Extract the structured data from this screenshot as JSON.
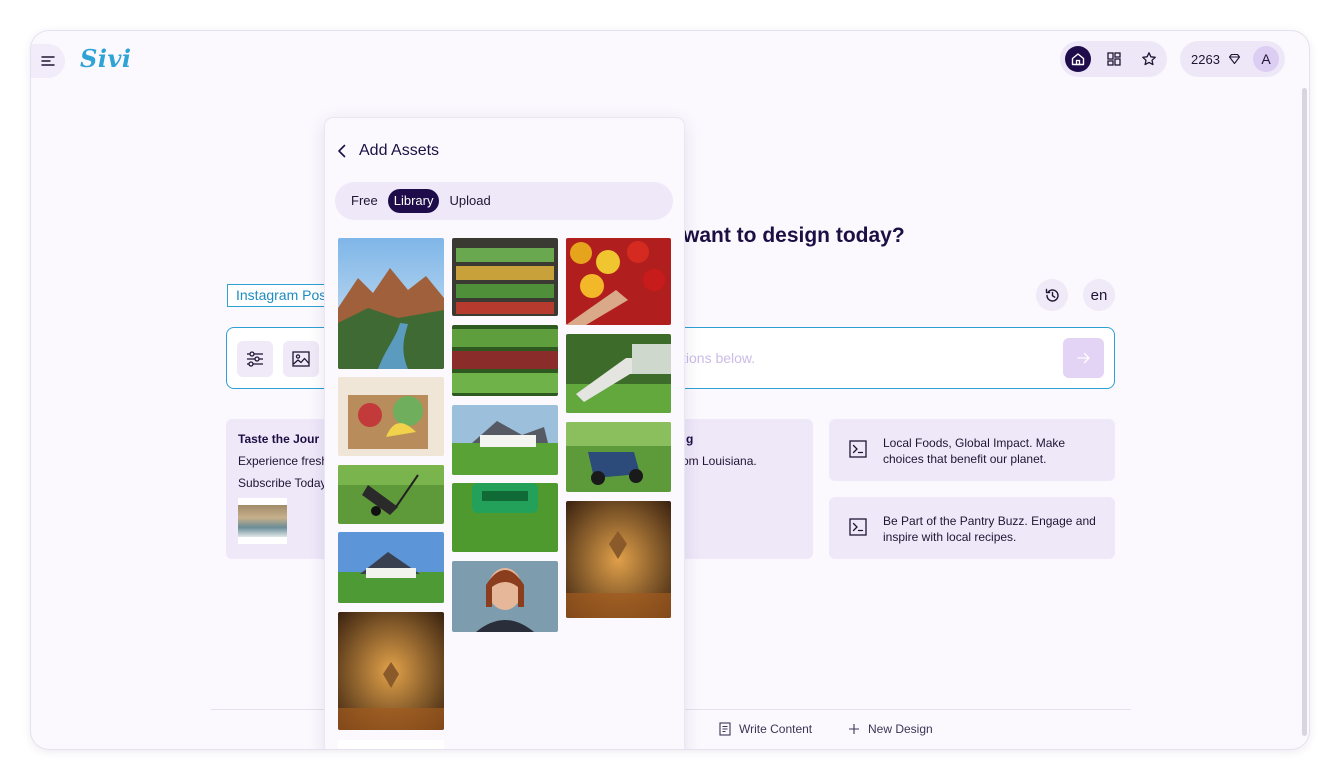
{
  "app": {
    "logo": "Sivi"
  },
  "header": {
    "nav": [
      {
        "icon": "home-icon",
        "active": true
      },
      {
        "icon": "grid-icon",
        "active": false
      },
      {
        "icon": "star-icon",
        "active": false
      }
    ],
    "credits": "2263",
    "avatar_initial": "A"
  },
  "main": {
    "headline": "want to design today?",
    "design_chip": "Instagram Post",
    "language": "en",
    "prompt_placeholder": "tions below.",
    "card_main": {
      "title": "Taste the Jour",
      "line1": "Experience fresh",
      "line2": "Subscribe Today",
      "title2": "g",
      "line3": "rom Louisiana."
    },
    "suggestions": [
      "Local Foods, Global Impact. Make choices that benefit our planet.",
      "Be Part of the Pantry Buzz. Engage and inspire with local recipes."
    ]
  },
  "footer": {
    "items": [
      {
        "icon": "document-icon",
        "label": "Write Content"
      },
      {
        "icon": "plus-icon",
        "label": "New Design"
      }
    ]
  },
  "assets_panel": {
    "title": "Add Assets",
    "tabs": [
      "Free",
      "Library",
      "Upload"
    ],
    "active_tab": "Library",
    "images": [
      "mountain river canyon",
      "grocery produce shelves",
      "red and yellow tomatoes",
      "grocery produce display",
      "garden stairs with lawn",
      "box of fresh vegetables",
      "house with green lawn",
      "lawn mower on grass",
      "lawn mower on grass",
      "green lawn mower closeup",
      "autumn leaf bokeh",
      "house with green lawn",
      "portrait of woman",
      "autumn leaf bokeh"
    ]
  },
  "colors": {
    "brand": "#1f0c4a",
    "accent": "#2ea0d4",
    "surface": "#efe8f9"
  }
}
